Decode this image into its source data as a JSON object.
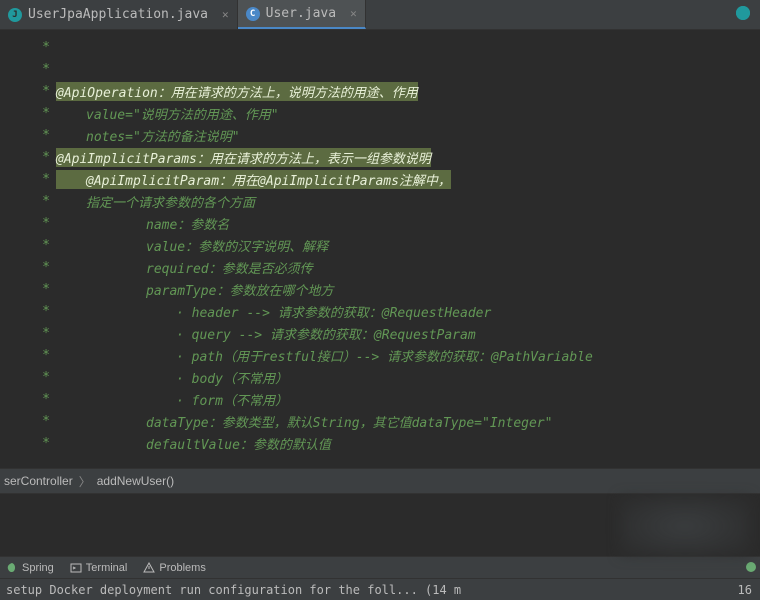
{
  "tabs": {
    "items": [
      {
        "label": "UserJpaApplication.java",
        "active": false
      },
      {
        "label": "User.java",
        "active": true
      }
    ]
  },
  "code": {
    "l0": "",
    "l1": "@ApiOperation：用在请求的方法上，说明方法的用途、作用",
    "l2": "value=\"说明方法的用途、作用\"",
    "l3": "notes=\"方法的备注说明\"",
    "l4": "@ApiImplicitParams：用在请求的方法上，表示一组参数说明",
    "l5": "@ApiImplicitParam：用在@ApiImplicitParams注解中，",
    "l6": "指定一个请求参数的各个方面",
    "l7": "name：参数名",
    "l8": "value：参数的汉字说明、解释",
    "l9": "required：参数是否必须传",
    "l10": "paramType：参数放在哪个地方",
    "l11": "· header --> 请求参数的获取：@RequestHeader",
    "l12": "· query --> 请求参数的获取：@RequestParam",
    "l13": "· path（用于restful接口）--> 请求参数的获取：@PathVariable",
    "l14": "· body（不常用）",
    "l15": "· form（不常用）",
    "l16": "dataType：参数类型，默认String，其它值dataType=\"Integer\"",
    "l17": "defaultValue：参数的默认值"
  },
  "breadcrumb": {
    "item1": "serController",
    "item2": "addNewUser()"
  },
  "tools": {
    "spring": "Spring",
    "terminal": "Terminal",
    "problems": "Problems"
  },
  "status": {
    "message": "setup Docker deployment run configuration for the foll... (14 m",
    "number": "16"
  }
}
